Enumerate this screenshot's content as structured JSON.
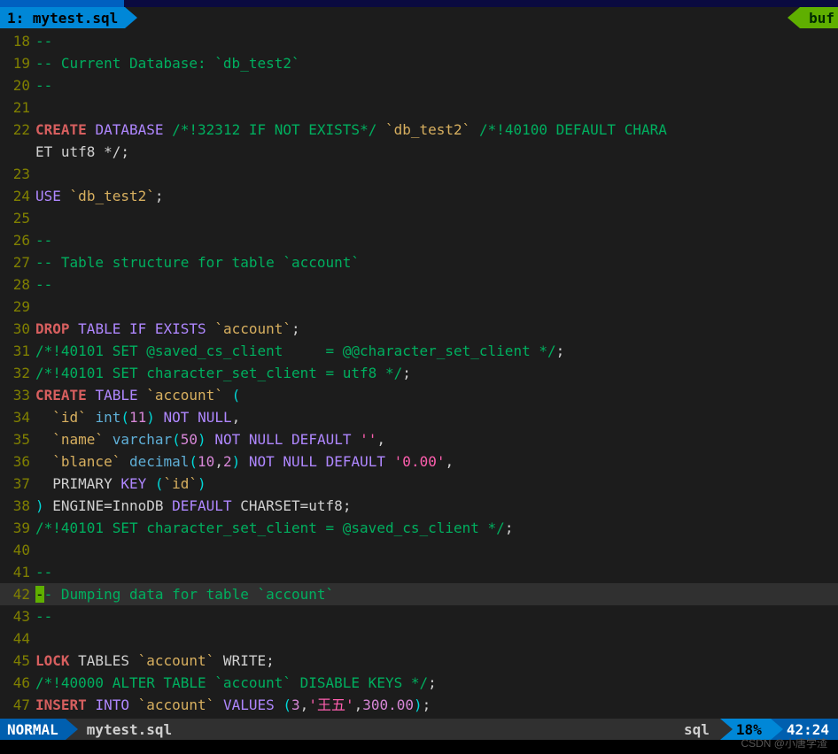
{
  "buffer": {
    "index": "1:",
    "name": "mytest.sql",
    "right_label": "buf"
  },
  "gutter_start": 18,
  "cursor_line": 42,
  "code_lines": [
    [
      [
        "comment",
        "--"
      ]
    ],
    [
      [
        "comment",
        "-- Current Database: `db_test2`"
      ]
    ],
    [
      [
        "comment",
        "--"
      ]
    ],
    [],
    [
      [
        "keyword",
        "CREATE"
      ],
      [
        "ident",
        " "
      ],
      [
        "keyword2",
        "DATABASE"
      ],
      [
        "ident",
        " "
      ],
      [
        "comment",
        "/*!32312 IF NOT EXISTS*/"
      ],
      [
        "ident",
        " "
      ],
      [
        "string",
        "`db_test2`"
      ],
      [
        "ident",
        " "
      ],
      [
        "comment",
        "/*!40100 DEFAULT CHARA"
      ]
    ],
    [
      [
        "ident",
        "ET utf8 */"
      ],
      [
        "op",
        ";"
      ]
    ],
    [],
    [
      [
        "keyword2",
        "USE"
      ],
      [
        "ident",
        " "
      ],
      [
        "string",
        "`db_test2`"
      ],
      [
        "op",
        ";"
      ]
    ],
    [],
    [
      [
        "comment",
        "--"
      ]
    ],
    [
      [
        "comment",
        "-- Table structure for table `account`"
      ]
    ],
    [
      [
        "comment",
        "--"
      ]
    ],
    [],
    [
      [
        "keyword",
        "DROP"
      ],
      [
        "ident",
        " "
      ],
      [
        "keyword2",
        "TABLE"
      ],
      [
        "ident",
        " "
      ],
      [
        "keyword2",
        "IF"
      ],
      [
        "ident",
        " "
      ],
      [
        "keyword2",
        "EXISTS"
      ],
      [
        "ident",
        " "
      ],
      [
        "string",
        "`account`"
      ],
      [
        "op",
        ";"
      ]
    ],
    [
      [
        "comment",
        "/*!40101 SET @saved_cs_client     = @@character_set_client */"
      ],
      [
        "op",
        ";"
      ]
    ],
    [
      [
        "comment",
        "/*!40101 SET character_set_client = utf8 */"
      ],
      [
        "op",
        ";"
      ]
    ],
    [
      [
        "keyword",
        "CREATE"
      ],
      [
        "ident",
        " "
      ],
      [
        "keyword2",
        "TABLE"
      ],
      [
        "ident",
        " "
      ],
      [
        "string",
        "`account`"
      ],
      [
        "ident",
        " "
      ],
      [
        "paren",
        "("
      ]
    ],
    [
      [
        "ident",
        "  "
      ],
      [
        "string",
        "`id`"
      ],
      [
        "ident",
        " "
      ],
      [
        "type",
        "int"
      ],
      [
        "paren",
        "("
      ],
      [
        "number",
        "11"
      ],
      [
        "paren",
        ")"
      ],
      [
        "ident",
        " "
      ],
      [
        "keyword2",
        "NOT"
      ],
      [
        "ident",
        " "
      ],
      [
        "keyword2",
        "NULL"
      ],
      [
        "op",
        ","
      ]
    ],
    [
      [
        "ident",
        "  "
      ],
      [
        "string",
        "`name`"
      ],
      [
        "ident",
        " "
      ],
      [
        "type",
        "varchar"
      ],
      [
        "paren",
        "("
      ],
      [
        "number",
        "50"
      ],
      [
        "paren",
        ")"
      ],
      [
        "ident",
        " "
      ],
      [
        "keyword2",
        "NOT"
      ],
      [
        "ident",
        " "
      ],
      [
        "keyword2",
        "NULL"
      ],
      [
        "ident",
        " "
      ],
      [
        "keyword2",
        "DEFAULT"
      ],
      [
        "ident",
        " "
      ],
      [
        "string2",
        "''"
      ],
      [
        "op",
        ","
      ]
    ],
    [
      [
        "ident",
        "  "
      ],
      [
        "string",
        "`blance`"
      ],
      [
        "ident",
        " "
      ],
      [
        "type",
        "decimal"
      ],
      [
        "paren",
        "("
      ],
      [
        "number",
        "10"
      ],
      [
        "op",
        ","
      ],
      [
        "number",
        "2"
      ],
      [
        "paren",
        ")"
      ],
      [
        "ident",
        " "
      ],
      [
        "keyword2",
        "NOT"
      ],
      [
        "ident",
        " "
      ],
      [
        "keyword2",
        "NULL"
      ],
      [
        "ident",
        " "
      ],
      [
        "keyword2",
        "DEFAULT"
      ],
      [
        "ident",
        " "
      ],
      [
        "string2",
        "'0.00'"
      ],
      [
        "op",
        ","
      ]
    ],
    [
      [
        "ident",
        "  PRIMARY "
      ],
      [
        "keyword2",
        "KEY"
      ],
      [
        "ident",
        " "
      ],
      [
        "paren",
        "("
      ],
      [
        "string",
        "`id`"
      ],
      [
        "paren",
        ")"
      ]
    ],
    [
      [
        "paren",
        ")"
      ],
      [
        "ident",
        " ENGINE=InnoDB "
      ],
      [
        "keyword2",
        "DEFAULT"
      ],
      [
        "ident",
        " CHARSET=utf8"
      ],
      [
        "op",
        ";"
      ]
    ],
    [
      [
        "comment",
        "/*!40101 SET character_set_client = @saved_cs_client */"
      ],
      [
        "op",
        ";"
      ]
    ],
    [],
    [
      [
        "comment",
        "--"
      ]
    ],
    [
      [
        "comment",
        "-- Dumping data for table `account`"
      ]
    ],
    [
      [
        "comment",
        "--"
      ]
    ],
    [],
    [
      [
        "keyword",
        "LOCK"
      ],
      [
        "ident",
        " TABLES "
      ],
      [
        "string",
        "`account`"
      ],
      [
        "ident",
        " WRITE"
      ],
      [
        "op",
        ";"
      ]
    ],
    [
      [
        "comment",
        "/*!40000 ALTER TABLE `account` DISABLE KEYS */"
      ],
      [
        "op",
        ";"
      ]
    ],
    [
      [
        "keyword",
        "INSERT"
      ],
      [
        "ident",
        " "
      ],
      [
        "keyword2",
        "INTO"
      ],
      [
        "ident",
        " "
      ],
      [
        "string",
        "`account`"
      ],
      [
        "ident",
        " "
      ],
      [
        "keyword2",
        "VALUES"
      ],
      [
        "ident",
        " "
      ],
      [
        "paren",
        "("
      ],
      [
        "number",
        "3"
      ],
      [
        "op",
        ","
      ],
      [
        "string2",
        "'王五'"
      ],
      [
        "op",
        ","
      ],
      [
        "number",
        "300.00"
      ],
      [
        "paren",
        ")"
      ],
      [
        "op",
        ";"
      ]
    ]
  ],
  "wrapped_line_after": 22,
  "status": {
    "mode": "NORMAL",
    "file": "mytest.sql",
    "ftype": "sql",
    "percent": "18%",
    "pos": "42:24"
  },
  "watermark": "CSDN @小唐学渣"
}
